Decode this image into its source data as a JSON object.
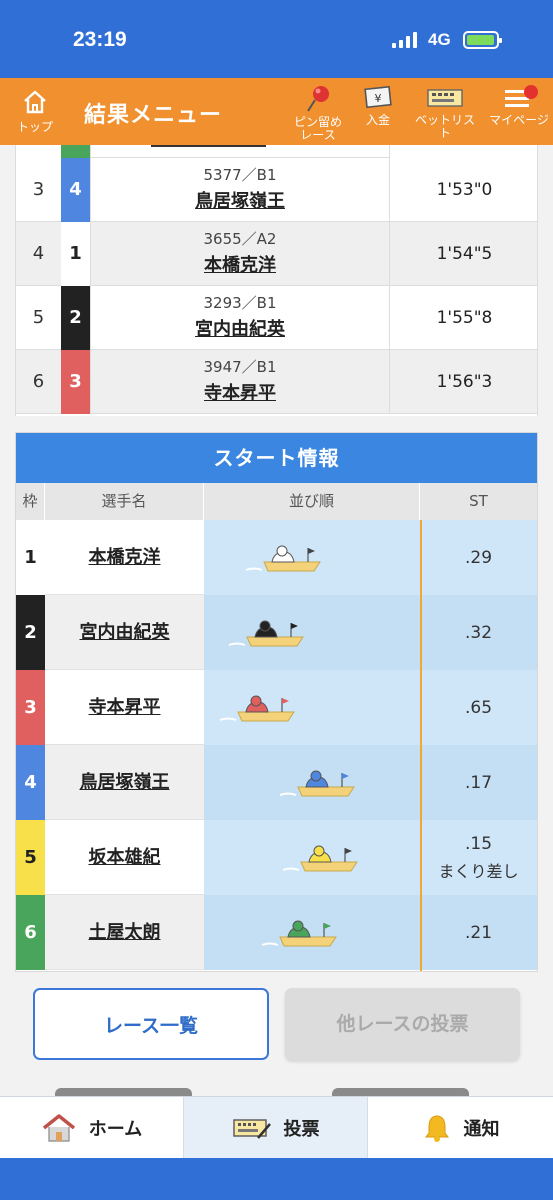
{
  "status_bar": {
    "time": "23:19",
    "network": "4G"
  },
  "header": {
    "home_label": "トップ",
    "title": "結果メニュー",
    "buttons": [
      {
        "label": "ピン留め\nレース",
        "icon": "pin-icon"
      },
      {
        "label": "入金",
        "icon": "deposit-icon"
      },
      {
        "label": "ベットリスト",
        "icon": "bet-list-icon"
      },
      {
        "label": "マイページ",
        "icon": "menu-icon"
      }
    ]
  },
  "results": [
    {
      "rank": "3",
      "waku": "4",
      "reg": "5377／B1",
      "name": "鳥居塚嶺王",
      "time": "1'53\"0"
    },
    {
      "rank": "4",
      "waku": "1",
      "reg": "3655／A2",
      "name": "本橋克洋",
      "time": "1'54\"5"
    },
    {
      "rank": "5",
      "waku": "2",
      "reg": "3293／B1",
      "name": "宮内由紀英",
      "time": "1'55\"8"
    },
    {
      "rank": "6",
      "waku": "3",
      "reg": "3947／B1",
      "name": "寺本昇平",
      "time": "1'56\"3"
    }
  ],
  "start_info": {
    "title": "スタート情報",
    "headers": {
      "waku": "枠",
      "name": "選手名",
      "order": "並び順",
      "st": "ST"
    },
    "rows": [
      {
        "waku": "1",
        "name": "本橋克洋",
        "st": ".29",
        "note": "",
        "boat_position": 0.25
      },
      {
        "waku": "2",
        "name": "宮内由紀英",
        "st": ".32",
        "note": "",
        "boat_position": 0.12
      },
      {
        "waku": "3",
        "name": "寺本昇平",
        "st": ".65",
        "note": "",
        "boat_position": 0.05
      },
      {
        "waku": "4",
        "name": "鳥居塚嶺王",
        "st": ".17",
        "note": "",
        "boat_position": 0.52
      },
      {
        "waku": "5",
        "name": "坂本雄紀",
        "st": ".15",
        "note": "まくり差し",
        "boat_position": 0.55
      },
      {
        "waku": "6",
        "name": "土屋太朗",
        "st": ".21",
        "note": "",
        "boat_position": 0.38
      }
    ]
  },
  "buttons": {
    "race_list": "レース一覧",
    "other_race_vote": "他レースの投票"
  },
  "bottom_nav": [
    {
      "label": "ホーム",
      "icon": "home-icon",
      "active": false
    },
    {
      "label": "投票",
      "icon": "ticket-icon",
      "active": true
    },
    {
      "label": "通知",
      "icon": "bell-icon",
      "active": false
    }
  ],
  "colors": {
    "status_blue": "#2f6fd6",
    "header_orange": "#f0902e",
    "waku": {
      "1": "#ffffff",
      "2": "#222222",
      "3": "#e06060",
      "4": "#4f86e0",
      "5": "#f7e04a",
      "6": "#4aa55c"
    },
    "waku_text": {
      "1": "#222222",
      "2": "#ffffff",
      "3": "#ffffff",
      "4": "#ffffff",
      "5": "#222222",
      "6": "#ffffff"
    }
  }
}
